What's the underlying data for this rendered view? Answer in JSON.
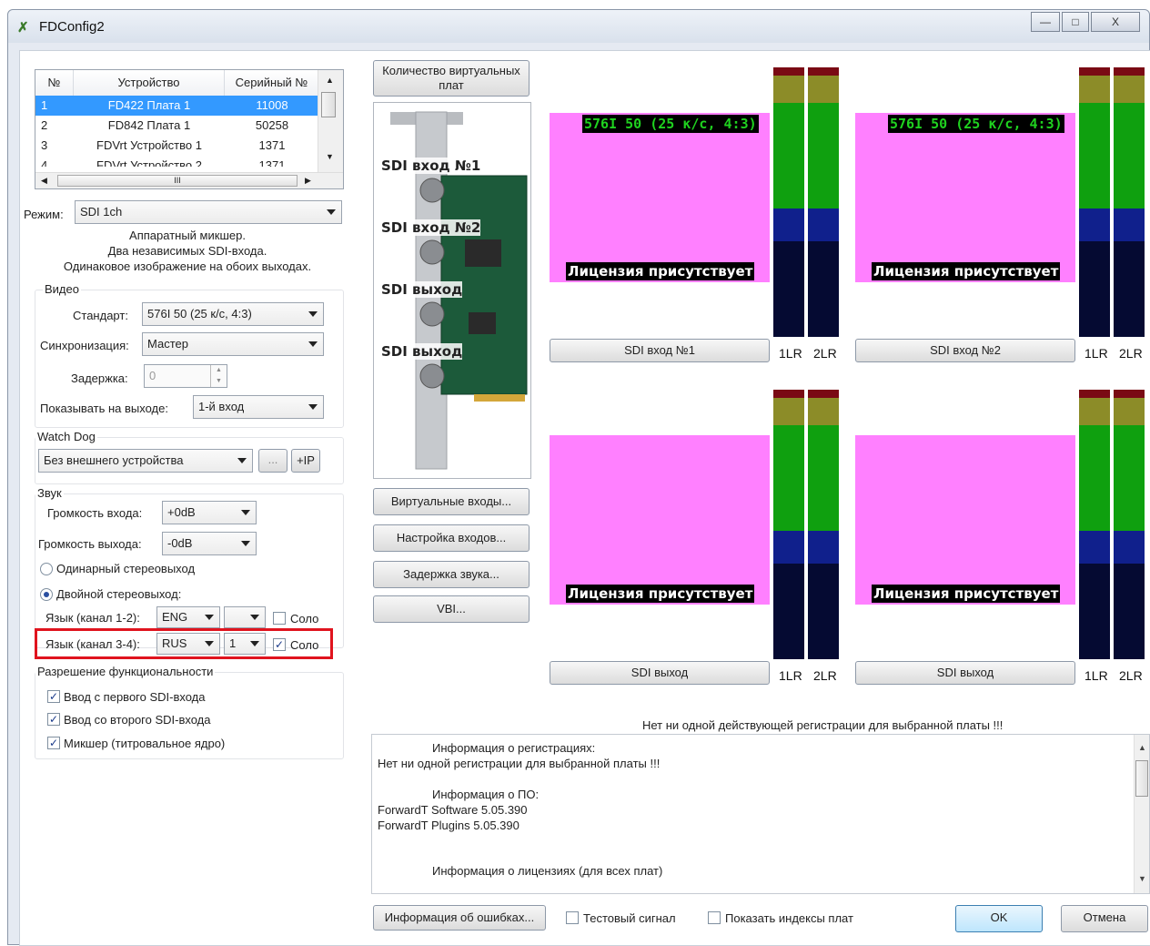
{
  "window": {
    "title": "FDConfig2",
    "min_label": "—",
    "max_label": "□",
    "close_label": "X"
  },
  "devices": {
    "headers": [
      "№",
      "Устройство",
      "Серийный №"
    ],
    "rows": [
      {
        "n": "1",
        "name": "FD422 Плата 1",
        "serial": "11008",
        "selected": true
      },
      {
        "n": "2",
        "name": "FD842 Плата 1",
        "serial": "50258"
      },
      {
        "n": "3",
        "name": "FDVrt Устройство 1",
        "serial": "1371"
      },
      {
        "n": "4",
        "name": "FDVrt Устройство 2",
        "serial": "1371"
      }
    ],
    "hscroll_label": "III"
  },
  "mode": {
    "label": "Режим:",
    "value": "SDI 1ch",
    "description": [
      "Аппаратный микшер.",
      "Два независимых SDI-входа.",
      "Одинаковое изображение на обоих выходах."
    ]
  },
  "video": {
    "title": "Видео",
    "standard_label": "Стандарт:",
    "standard_value": "576I 50 (25 к/с, 4:3)",
    "sync_label": "Синхронизация:",
    "sync_value": "Мастер",
    "delay_label": "Задержка:",
    "delay_value": "0",
    "output_label": "Показывать на выходе:",
    "output_value": "1-й вход"
  },
  "watchdog": {
    "title": "Watch Dog",
    "device_value": "Без внешнего устройства",
    "dots_label": "...",
    "ip_label": "+IP"
  },
  "sound": {
    "title": "Звук",
    "in_volume_label": "Громкость входа:",
    "in_volume_value": "+0dB",
    "out_volume_label": "Громкость выхода:",
    "out_volume_value": "-0dB",
    "single_stereo_label": "Одинарный стереовыход",
    "double_stereo_label": "Двойной стереовыход:",
    "lang12_label": "Язык (канал 1-2):",
    "lang12_value": "ENG",
    "lang12_extra": "",
    "solo12_label": "Соло",
    "lang34_label": "Язык (канал 3-4):",
    "lang34_value": "RUS",
    "lang34_extra": "1",
    "solo34_label": "Соло"
  },
  "features": {
    "title": "Разрешение функциональности",
    "items": [
      "Ввод с первого SDI-входа",
      "Ввод со второго SDI-входа",
      "Микшер (титровальное ядро)"
    ]
  },
  "middle": {
    "virtual_boards_label": "Количество виртуальных плат",
    "card_labels": [
      "SDI вход №1",
      "SDI вход №2",
      "SDI выход",
      "SDI выход"
    ],
    "virtual_inputs_label": "Виртуальные входы...",
    "inputs_setup_label": "Настройка входов...",
    "sound_delay_label": "Задержка звука...",
    "vbi_label": "VBI..."
  },
  "previews": [
    {
      "format": "576I 50 (25 к/с, 4:3)",
      "license": "Лицензия присутствует",
      "button": "SDI вход №1",
      "meter1": "1LR",
      "meter2": "2LR"
    },
    {
      "format": "576I 50 (25 к/с, 4:3)",
      "license": "Лицензия присутствует",
      "button": "SDI вход №2",
      "meter1": "1LR",
      "meter2": "2LR"
    },
    {
      "format": "",
      "license": "Лицензия присутствует",
      "button": "SDI выход",
      "meter1": "1LR",
      "meter2": "2LR"
    },
    {
      "format": "",
      "license": "Лицензия присутствует",
      "button": "SDI выход",
      "meter1": "1LR",
      "meter2": "2LR"
    }
  ],
  "colors": {
    "preview": "#ff80ff",
    "meter_red": "#7a0a14",
    "meter_olive": "#8c8c28",
    "meter_green": "#0fa00f",
    "meter_blue": "#10208c",
    "meter_dark": "#050a32"
  },
  "registration_warning": "Нет ни одной действующей регистрации для выбранной платы !!!",
  "info_lines": [
    "Информация о регистрациях:",
    "Нет ни одной регистрации для выбранной платы !!!",
    "",
    "Информация о ПО:",
    "ForwardT Software 5.05.390",
    "ForwardT Plugins 5.05.390",
    "",
    "Информация о лицензиях (для всех плат)"
  ],
  "footer": {
    "errors_label": "Информация об ошибках...",
    "test_signal_label": "Тестовый сигнал",
    "show_indexes_label": "Показать индексы плат",
    "ok_label": "OK",
    "cancel_label": "Отмена"
  }
}
